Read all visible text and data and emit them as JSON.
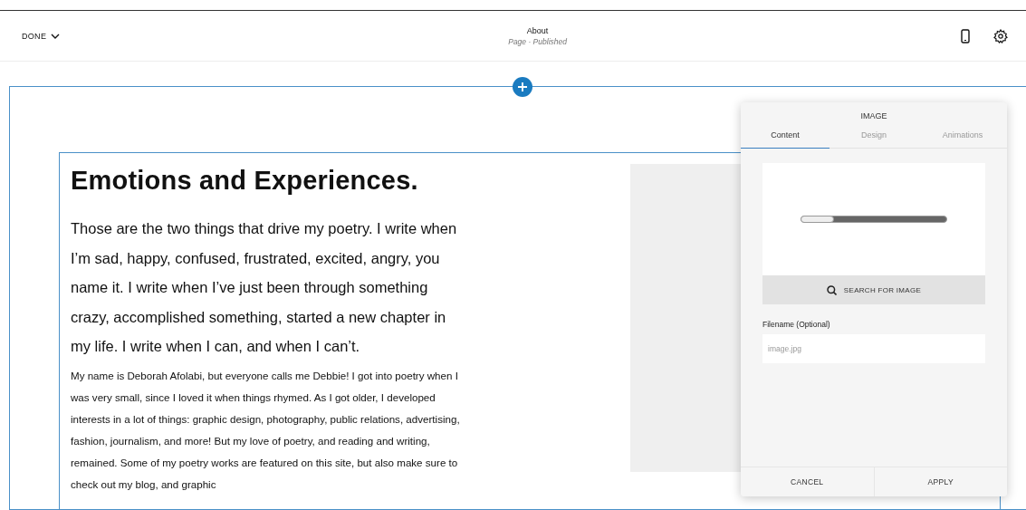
{
  "header": {
    "done_label": "DONE",
    "page_title": "About",
    "page_status": "Page · Published"
  },
  "section": {
    "heading": "Emotions and Experiences.",
    "intro": "Those are the two things that drive my poetry. I write when I’m sad, happy, confused, frustrated, excited, angry, you name it. I write when I’ve just been through something crazy, accomplished something, started a new chapter in my life. I write when I can, and when I can’t.",
    "body": "My name is Deborah Afolabi, but everyone calls me Debbie! I got into poetry when I was very small, since I loved it when things rhymed. As I got older, I developed interests in a lot of things: graphic design, photography, public relations, advertising, fashion, journalism, and more! But my love of poetry, and reading and writing, remained. Some of my poetry works are featured on this site, but also make sure to check out my blog, and graphic"
  },
  "image_panel": {
    "title": "IMAGE",
    "tabs": [
      {
        "label": "Content",
        "selected": true
      },
      {
        "label": "Design",
        "selected": false
      },
      {
        "label": "Animations",
        "selected": false
      }
    ],
    "search_button": "SEARCH FOR IMAGE",
    "filename_label": "Filename (Optional)",
    "filename_placeholder": "image.jpg",
    "buttons": [
      "CANCEL",
      "APPLY"
    ]
  }
}
